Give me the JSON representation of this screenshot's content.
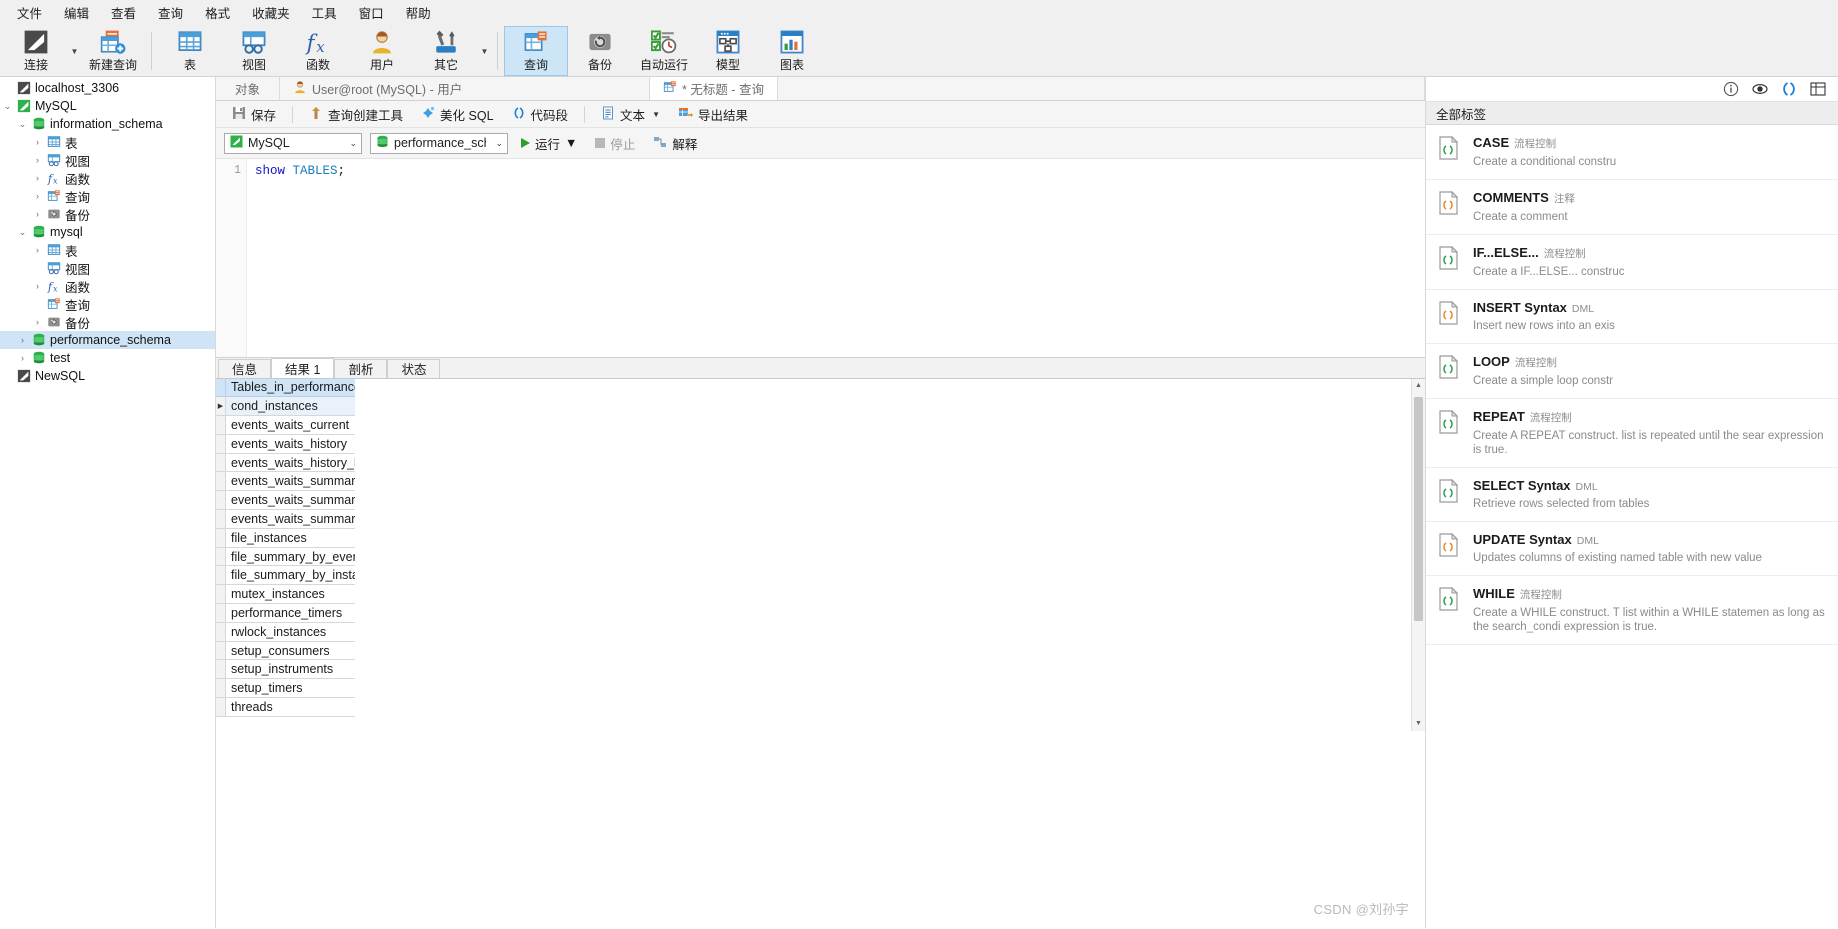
{
  "menu": {
    "items": [
      "文件",
      "编辑",
      "查看",
      "查询",
      "格式",
      "收藏夹",
      "工具",
      "窗口",
      "帮助"
    ]
  },
  "ribbon": {
    "items": [
      {
        "label": "连接",
        "icon": "connection-icon",
        "selected": false,
        "caret": true
      },
      {
        "label": "新建查询",
        "icon": "new-query-icon",
        "selected": false,
        "caret": false
      },
      {
        "label": "表",
        "icon": "table-icon",
        "selected": false,
        "caret": false
      },
      {
        "label": "视图",
        "icon": "view-icon",
        "selected": false,
        "caret": false
      },
      {
        "label": "函数",
        "icon": "function-icon",
        "selected": false,
        "caret": false
      },
      {
        "label": "用户",
        "icon": "user-icon",
        "selected": false,
        "caret": false
      },
      {
        "label": "其它",
        "icon": "other-tools-icon",
        "selected": false,
        "caret": true
      },
      {
        "label": "查询",
        "icon": "query-icon",
        "selected": true,
        "caret": false
      },
      {
        "label": "备份",
        "icon": "backup-icon",
        "selected": false,
        "caret": false
      },
      {
        "label": "自动运行",
        "icon": "automation-icon",
        "selected": false,
        "caret": false
      },
      {
        "label": "模型",
        "icon": "model-icon",
        "selected": false,
        "caret": false
      },
      {
        "label": "图表",
        "icon": "chart-icon",
        "selected": false,
        "caret": false
      }
    ]
  },
  "tree": {
    "nodes": [
      {
        "label": "localhost_3306",
        "indent": 1,
        "twist": "",
        "icon": "connection-icon",
        "selected": false
      },
      {
        "label": "MySQL",
        "indent": 1,
        "twist": "down",
        "icon": "connection-green-icon",
        "selected": false
      },
      {
        "label": "information_schema",
        "indent": 2,
        "twist": "down",
        "icon": "database-icon",
        "selected": false
      },
      {
        "label": "表",
        "indent": 3,
        "twist": "right",
        "icon": "table-icon",
        "selected": false
      },
      {
        "label": "视图",
        "indent": 3,
        "twist": "right",
        "icon": "view-icon",
        "selected": false
      },
      {
        "label": "函数",
        "indent": 3,
        "twist": "right",
        "icon": "function-icon",
        "selected": false
      },
      {
        "label": "查询",
        "indent": 3,
        "twist": "right",
        "icon": "query-icon",
        "selected": false
      },
      {
        "label": "备份",
        "indent": 3,
        "twist": "right",
        "icon": "backup-icon",
        "selected": false
      },
      {
        "label": "mysql",
        "indent": 2,
        "twist": "down",
        "icon": "database-icon",
        "selected": false
      },
      {
        "label": "表",
        "indent": 3,
        "twist": "right",
        "icon": "table-icon",
        "selected": false
      },
      {
        "label": "视图",
        "indent": 3,
        "twist": "",
        "icon": "view-icon",
        "selected": false
      },
      {
        "label": "函数",
        "indent": 3,
        "twist": "right",
        "icon": "function-icon",
        "selected": false
      },
      {
        "label": "查询",
        "indent": 3,
        "twist": "",
        "icon": "query-icon",
        "selected": false
      },
      {
        "label": "备份",
        "indent": 3,
        "twist": "right",
        "icon": "backup-icon",
        "selected": false
      },
      {
        "label": "performance_schema",
        "indent": 2,
        "twist": "right",
        "icon": "database-icon",
        "selected": true
      },
      {
        "label": "test",
        "indent": 2,
        "twist": "right",
        "icon": "database-icon",
        "selected": false
      },
      {
        "label": "NewSQL",
        "indent": 1,
        "twist": "",
        "icon": "connection-icon",
        "selected": false
      }
    ]
  },
  "doc_tabs": {
    "object_tab": "对象",
    "tabs": [
      {
        "label": "User@root (MySQL) - 用户",
        "icon": "user-icon",
        "active": false,
        "modified": false
      },
      {
        "label": "* 无标题 - 查询",
        "icon": "query-icon",
        "active": true,
        "modified": true
      }
    ]
  },
  "query_toolbar": {
    "save": "保存",
    "query_builder": "查询创建工具",
    "beautify_sql": "美化 SQL",
    "snippet": "代码段",
    "text": "文本",
    "export_result": "导出结果"
  },
  "db_row": {
    "connection": "MySQL",
    "database": "performance_schem",
    "run": "运行",
    "stop": "停止",
    "explain": "解释"
  },
  "editor": {
    "line_numbers": [
      "1"
    ],
    "code_keyword": "show",
    "code_keyword2": "TABLES",
    "code_punct": ";",
    "full_text": "show TABLES;"
  },
  "result_tabs": {
    "tabs": [
      {
        "label": "信息",
        "active": false
      },
      {
        "label": "结果 1",
        "active": true
      },
      {
        "label": "剖析",
        "active": false
      },
      {
        "label": "状态",
        "active": false
      }
    ]
  },
  "result_grid": {
    "column_header": "Tables_in_performance_sc",
    "rows": [
      {
        "value": "cond_instances",
        "current": true
      },
      {
        "value": "events_waits_current",
        "current": false
      },
      {
        "value": "events_waits_history",
        "current": false
      },
      {
        "value": "events_waits_history_long",
        "current": false
      },
      {
        "value": "events_waits_summary_by",
        "current": false
      },
      {
        "value": "events_waits_summary_by",
        "current": false
      },
      {
        "value": "events_waits_summary_glo",
        "current": false
      },
      {
        "value": "file_instances",
        "current": false
      },
      {
        "value": "file_summary_by_event_na",
        "current": false
      },
      {
        "value": "file_summary_by_instance",
        "current": false
      },
      {
        "value": "mutex_instances",
        "current": false
      },
      {
        "value": "performance_timers",
        "current": false
      },
      {
        "value": "rwlock_instances",
        "current": false
      },
      {
        "value": "setup_consumers",
        "current": false
      },
      {
        "value": "setup_instruments",
        "current": false
      },
      {
        "value": "setup_timers",
        "current": false
      },
      {
        "value": "threads",
        "current": false
      }
    ]
  },
  "right_panel": {
    "header_icons": [
      "info-icon",
      "eye-icon",
      "snippet-icon",
      "grid-icon"
    ],
    "tag_filter": "全部标签",
    "snippets": [
      {
        "title": "CASE",
        "category": "流程控制",
        "desc": "Create a conditional constru",
        "icon_color": "#2e9e4f"
      },
      {
        "title": "COMMENTS",
        "category": "注释",
        "desc": "Create a comment",
        "icon_color": "#e08b2a"
      },
      {
        "title": "IF...ELSE...",
        "category": "流程控制",
        "desc": "Create a IF...ELSE... construc",
        "icon_color": "#2e9e4f"
      },
      {
        "title": "INSERT Syntax",
        "category": "DML",
        "desc": "Insert new rows into an exis",
        "icon_color": "#e08b2a"
      },
      {
        "title": "LOOP",
        "category": "流程控制",
        "desc": "Create a simple loop constr",
        "icon_color": "#2e9e4f"
      },
      {
        "title": "REPEAT",
        "category": "流程控制",
        "desc": "Create A REPEAT construct. list is repeated until the sear expression is true.",
        "icon_color": "#2e9e4f"
      },
      {
        "title": "SELECT Syntax",
        "category": "DML",
        "desc": "Retrieve rows selected from tables",
        "icon_color": "#2e9e4f"
      },
      {
        "title": "UPDATE Syntax",
        "category": "DML",
        "desc": "Updates columns of existing named table with new value",
        "icon_color": "#e08b2a"
      },
      {
        "title": "WHILE",
        "category": "流程控制",
        "desc": "Create a WHILE construct. T list within a WHILE statemen as long as the search_condi expression is true.",
        "icon_color": "#2e9e4f"
      }
    ]
  },
  "watermark": "CSDN @刘孙宇"
}
